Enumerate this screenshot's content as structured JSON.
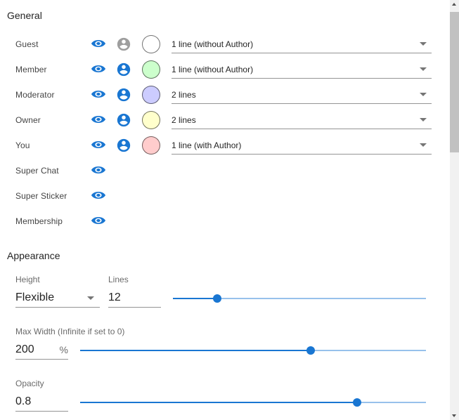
{
  "general": {
    "title": "General",
    "roles": [
      {
        "label": "Guest",
        "person_color": "#9e9e9e",
        "swatch_color": "#ffffff",
        "display": "1 line (without Author)"
      },
      {
        "label": "Member",
        "person_color": "#1976d2",
        "swatch_color": "#ccffcc",
        "display": "1 line (without Author)"
      },
      {
        "label": "Moderator",
        "person_color": "#1976d2",
        "swatch_color": "#ccccff",
        "display": "2 lines"
      },
      {
        "label": "Owner",
        "person_color": "#1976d2",
        "swatch_color": "#ffffcc",
        "display": "2 lines"
      },
      {
        "label": "You",
        "person_color": "#1976d2",
        "swatch_color": "#ffcccc",
        "display": "1 line (with Author)"
      }
    ],
    "events": [
      {
        "label": "Super Chat"
      },
      {
        "label": "Super Sticker"
      },
      {
        "label": "Membership"
      }
    ]
  },
  "appearance": {
    "title": "Appearance",
    "height": {
      "label": "Height",
      "value": "Flexible"
    },
    "lines": {
      "label": "Lines",
      "value": "12",
      "slider_fraction": 0.175
    },
    "max_width": {
      "label": "Max Width (Infinite if set to 0)",
      "value": "200",
      "unit": "%",
      "slider_fraction": 0.667
    },
    "opacity": {
      "label": "Opacity",
      "value": "0.8",
      "slider_fraction": 0.8
    }
  },
  "colors": {
    "accent": "#1976d2",
    "eye": "#1976d2"
  }
}
